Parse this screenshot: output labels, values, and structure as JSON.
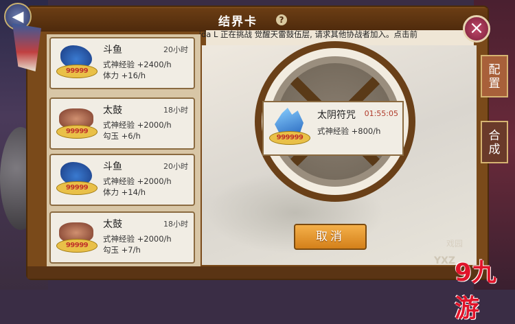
{
  "title": "结界卡",
  "help_icon": "?",
  "message": "ida L 正在挑战 觉醒天雷鼓伍层, 请求其他协战者加入。点击前",
  "close_icon": "×",
  "back_icon": "◀",
  "cards": [
    {
      "name": "斗鱼",
      "time": "20小时",
      "line1": "式神经验 +2400/h",
      "line2": "体力 +16/h",
      "stars": "99999",
      "icon": "fish-icon"
    },
    {
      "name": "太鼓",
      "time": "18小时",
      "line1": "式神经验 +2000/h",
      "line2": "勾玉 +6/h",
      "stars": "99999",
      "icon": "drum-icon"
    },
    {
      "name": "斗鱼",
      "time": "20小时",
      "line1": "式神经验 +2000/h",
      "line2": "体力 +14/h",
      "stars": "99999",
      "icon": "fish-icon"
    },
    {
      "name": "太鼓",
      "time": "18小时",
      "line1": "式神经验 +2000/h",
      "line2": "勾玉 +7/h",
      "stars": "99999",
      "icon": "drum-icon"
    }
  ],
  "active_card": {
    "name": "太阴符咒",
    "time": "01:55:05",
    "line1": "式神经验 +800/h",
    "stars": "999999",
    "icon": "crystal-icon"
  },
  "cancel_label": "取消",
  "tabs": {
    "config": "配置",
    "combine": "合成"
  },
  "watermark": {
    "site": "YXZ",
    "small": "戏园",
    "logo": "9九游"
  }
}
